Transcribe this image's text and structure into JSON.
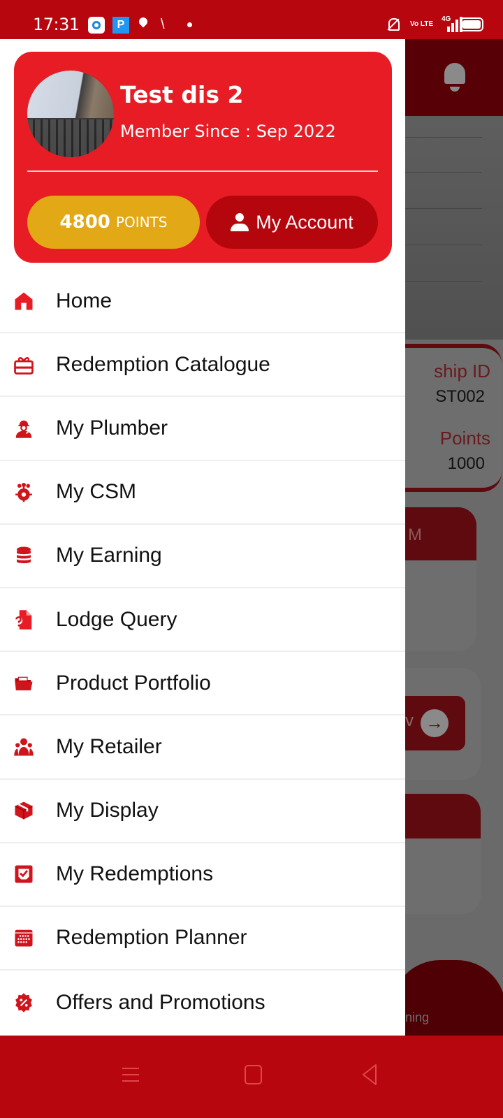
{
  "status_bar": {
    "time": "17:31",
    "app2_letter": "P",
    "volte": "Vo LTE",
    "network": "4G"
  },
  "profile": {
    "name": "Test dis 2",
    "member_since": "Member Since : Sep 2022",
    "points_value": "4800",
    "points_unit": "POINTS",
    "account_label": "My Account"
  },
  "menu": {
    "items": [
      {
        "label": "Home",
        "icon": "home-icon"
      },
      {
        "label": "Redemption Catalogue",
        "icon": "gift-icon"
      },
      {
        "label": "My Plumber",
        "icon": "plumber-icon"
      },
      {
        "label": "My CSM",
        "icon": "team-gear-icon"
      },
      {
        "label": "My Earning",
        "icon": "coin-stack-icon"
      },
      {
        "label": "Lodge Query",
        "icon": "query-document-icon"
      },
      {
        "label": "Product Portfolio",
        "icon": "folder-open-icon"
      },
      {
        "label": "My Retailer",
        "icon": "users-icon"
      },
      {
        "label": "My Display",
        "icon": "package-icon"
      },
      {
        "label": "My Redemptions",
        "icon": "checkbox-icon"
      },
      {
        "label": "Redemption Planner",
        "icon": "calendar-icon"
      },
      {
        "label": "Offers and Promotions",
        "icon": "discount-badge-icon"
      }
    ]
  },
  "background_app": {
    "card1_label1": "ship ID",
    "card1_value1": "ST002",
    "card1_label2": "Points",
    "card1_value2": "1000",
    "card2_title": "M",
    "card3_button_text": "v",
    "nav_text": "ning"
  },
  "colors": {
    "brand_red": "#e81c24",
    "dark_red": "#b8060f",
    "points_gold": "#e3a815"
  }
}
